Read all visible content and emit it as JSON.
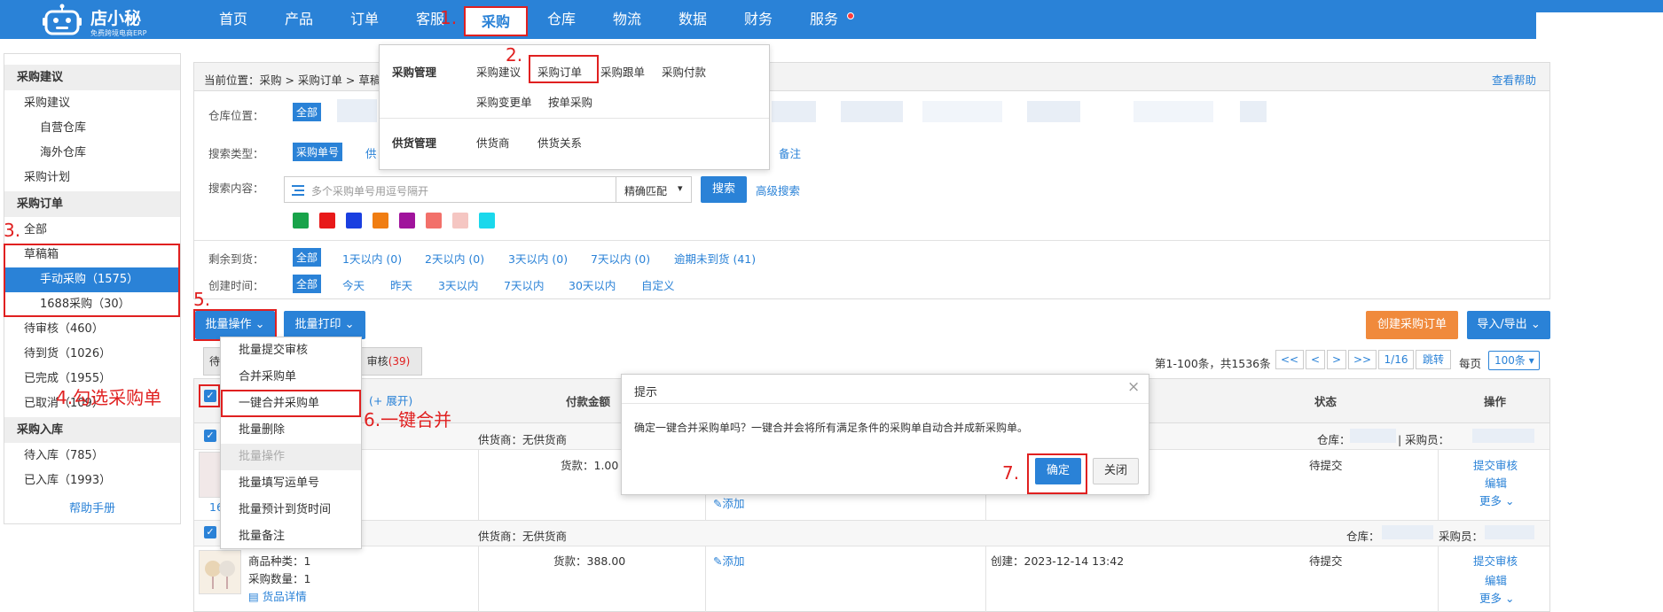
{
  "header": {
    "brand": "店小秘",
    "brand_sub": "免费跨境电商ERP",
    "nav": [
      "首页",
      "产品",
      "订单",
      "客服",
      "采购",
      "仓库",
      "物流",
      "数据",
      "财务",
      "服务"
    ],
    "active_nav": "采购"
  },
  "annotations": {
    "s1": "1.",
    "s2": "2.",
    "s3": "3.",
    "s4": "4.勾选采购单",
    "s5": "5.",
    "s6": "6.一键合并",
    "s7": "7."
  },
  "purchase_menu": {
    "group1_title": "采购管理",
    "group1_items": [
      "采购建议",
      "采购订单",
      "采购跟单",
      "采购付款",
      "采购变更单",
      "按单采购"
    ],
    "group2_title": "供货管理",
    "group2_items": [
      "供货商",
      "供货关系"
    ]
  },
  "sidebar": {
    "sec1": "采购建议",
    "sec1_items": [
      "采购建议",
      "自营仓库",
      "海外仓库",
      "采购计划"
    ],
    "sec2": "采购订单",
    "all": "全部",
    "draft": "草稿箱",
    "manual": "手动采购（1575）",
    "ali": "1688采购（30）",
    "status_items": [
      "待审核（460）",
      "待到货（1026）",
      "已完成（1955）",
      "已取消（109）"
    ],
    "sec3": "采购入库",
    "stock_items": [
      "待入库（785）",
      "已入库（1993）"
    ],
    "help": "帮助手册"
  },
  "breadcrumb": {
    "text": "当前位置：采购 > 采购订单 > 草稿",
    "help": "查看帮助"
  },
  "filters": {
    "warehouse_label": "仓库位置：",
    "all": "全部",
    "search_type_label": "搜索类型：",
    "search_type_selected": "采购单号",
    "search_type_partial": "供",
    "search_type_note": "备注",
    "search_content_label": "搜索内容：",
    "search_placeholder": "多个采购单号用逗号隔开",
    "match_mode": "精确匹配",
    "search_btn": "搜索",
    "advanced": "高级搜索",
    "colors": [
      "#18a34a",
      "#e81919",
      "#1a3fe0",
      "#f07d12",
      "#a0139c",
      "#f2706a",
      "#f5c6c2",
      "#1ad8ec"
    ],
    "remain_label": "剩余到货：",
    "remain_opts": [
      "1天以内 (0)",
      "2天以内 (0)",
      "3天以内 (0)",
      "7天以内 (0)",
      "逾期未到货 (41)"
    ],
    "created_label": "创建时间：",
    "created_opts": [
      "今天",
      "昨天",
      "3天以内",
      "7天以内",
      "30天以内",
      "自定义"
    ]
  },
  "toolbar": {
    "batch_op": "批量操作",
    "batch_print": "批量打印",
    "create": "创建采购订单",
    "import_export": "导入/导出"
  },
  "batch_menu": {
    "items": [
      "批量提交审核",
      "合并采购单",
      "一键合并采购单",
      "批量删除",
      "批量操作",
      "批量填写运单号",
      "批量预计到货时间",
      "批量备注"
    ]
  },
  "tabs": {
    "tab1_partial": "待",
    "tab2": "审核",
    "tab2_count": "(39)"
  },
  "pagination": {
    "summary": "第1-100条，共1536条",
    "first": "<<",
    "prev": "<",
    "next": ">",
    "last": ">>",
    "page": "1/16",
    "jump": "跳转",
    "per_page_label": "每页",
    "per_page": "100条"
  },
  "table": {
    "expand": "(+ 展开)",
    "col_pay": "付款金额",
    "col_status": "状态",
    "col_op": "操作",
    "rows": [
      {
        "supplier": "供货商：无供货商",
        "warehouse_label": "仓库：",
        "buyer_label": "| 采购员：",
        "amount": "货款：1.00",
        "add": "添加",
        "status": "待提交",
        "ops": [
          "提交审核",
          "编辑",
          "更多"
        ],
        "partial_code": "16"
      },
      {
        "supplier": "供货商：无供货商",
        "warehouse_label": "仓库：",
        "buyer_label": "采购员：",
        "amount": "货款：388.00",
        "add": "添加",
        "created": "创建：2023-12-14 13:42",
        "status": "待提交",
        "ops": [
          "提交审核",
          "编辑",
          "更多"
        ],
        "kinds": "商品种类：1",
        "qty": "采购数量：1",
        "detail": "货品详情"
      }
    ]
  },
  "dialog": {
    "title": "提示",
    "message": "确定一键合并采购单吗？一键合并会将所有满足条件的采购单自动合并成新采购单。",
    "ok": "确定",
    "cancel": "关闭",
    "close": "×"
  }
}
